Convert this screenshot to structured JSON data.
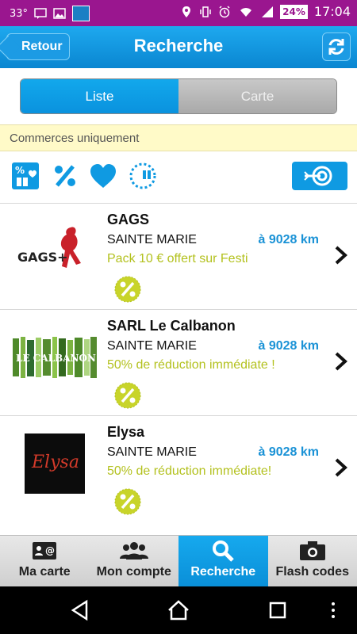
{
  "status_bar": {
    "temperature": "33°",
    "battery": "24%",
    "time": "17:04",
    "icons": [
      "message-icon",
      "image-icon",
      "app-icon",
      "location-icon",
      "vibrate-icon",
      "alarm-icon",
      "wifi-icon",
      "signal-icon"
    ]
  },
  "appbar": {
    "back_label": "Retour",
    "title": "Recherche",
    "refresh_icon": "refresh-icon"
  },
  "view_toggle": {
    "list_label": "Liste",
    "map_label": "Carte",
    "selected": "Liste"
  },
  "banner": {
    "text": "Commerces uniquement"
  },
  "filters": [
    "gift-heart-icon",
    "percent-icon",
    "heart-icon",
    "gift-circle-icon"
  ],
  "results": [
    {
      "name": "GAGS",
      "city": "SAINTE MARIE",
      "distance": "à 9028 km",
      "offer": "Pack 10 € offert sur Festi",
      "logo_text": "GAGS+"
    },
    {
      "name": "SARL Le Calbanon",
      "city": "SAINTE MARIE",
      "distance": "à 9028 km",
      "offer": "50% de réduction immédiate !",
      "logo_text": "LE CALBANON"
    },
    {
      "name": "Elysa",
      "city": "SAINTE MARIE",
      "distance": "à 9028 km",
      "offer": "50% de réduction immédiate!",
      "logo_text": "Elysa"
    }
  ],
  "tabs": [
    {
      "label": "Ma carte",
      "icon": "card-icon"
    },
    {
      "label": "Mon compte",
      "icon": "users-icon"
    },
    {
      "label": "Recherche",
      "icon": "search-icon",
      "active": true
    },
    {
      "label": "Flash codes",
      "icon": "camera-icon"
    }
  ],
  "colors": {
    "status_bar": "#9a168f",
    "accent": "#0a92de",
    "offer": "#b3c11e",
    "banner": "#fffac8"
  }
}
